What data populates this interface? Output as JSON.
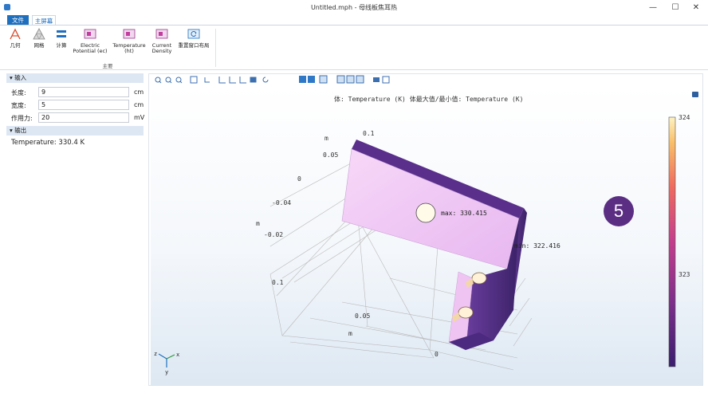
{
  "window": {
    "title": "Untitled.mph - 母线板焦耳热",
    "minimize": "—",
    "maximize": "☐",
    "close": "✕"
  },
  "ribbon": {
    "tabs": [
      "文件",
      "主屏幕"
    ],
    "buttons": [
      {
        "label": "几何",
        "icon": "geometry-icon"
      },
      {
        "label": "网格",
        "icon": "mesh-icon"
      },
      {
        "label": "计算",
        "icon": "compute-icon"
      },
      {
        "label": "Electric Potential (ec)",
        "line1": "Electric",
        "line2": "Potential (ec)",
        "icon": "plot-icon"
      },
      {
        "label": "Temperature (ht)",
        "line1": "Temperature",
        "line2": "(ht)",
        "icon": "plot-icon"
      },
      {
        "label": "Current Density",
        "line1": "Current",
        "line2": "Density",
        "icon": "plot-icon"
      },
      {
        "label": "重置窗口布局",
        "icon": "reset-layout-icon"
      }
    ],
    "group_label": "主要"
  },
  "inputs": {
    "header": "▾ 输入",
    "fields": [
      {
        "label": "长度:",
        "value": "9",
        "unit": "cm"
      },
      {
        "label": "宽度:",
        "value": "5",
        "unit": "cm"
      },
      {
        "label": "作用力:",
        "value": "20",
        "unit": "mV"
      }
    ]
  },
  "outputs": {
    "header": "▾ 输出",
    "temperature": "Temperature:  330.4 K"
  },
  "graphics": {
    "title": "体: Temperature (K)  体最大值/最小值: Temperature (K)",
    "max_label": "max: 330.415",
    "min_label": "min: 322.416",
    "colorbar_labels": [
      "324",
      "323"
    ],
    "axis_labels": {
      "z_ticks": [
        "0.1",
        "0.05",
        "0"
      ],
      "y_ticks": [
        "-0.04",
        "-0.02"
      ],
      "x_ticks": [
        "0.1",
        "0.05",
        "0"
      ],
      "unit_m": "m"
    },
    "triad": {
      "z": "z",
      "x": "x",
      "y": "y"
    },
    "badge": "5"
  },
  "colors": {
    "accent": "#1f6fbf",
    "plate_top": "#f2c9f5",
    "plate_dark": "#4b2a7f",
    "badge": "#5b2e83"
  }
}
